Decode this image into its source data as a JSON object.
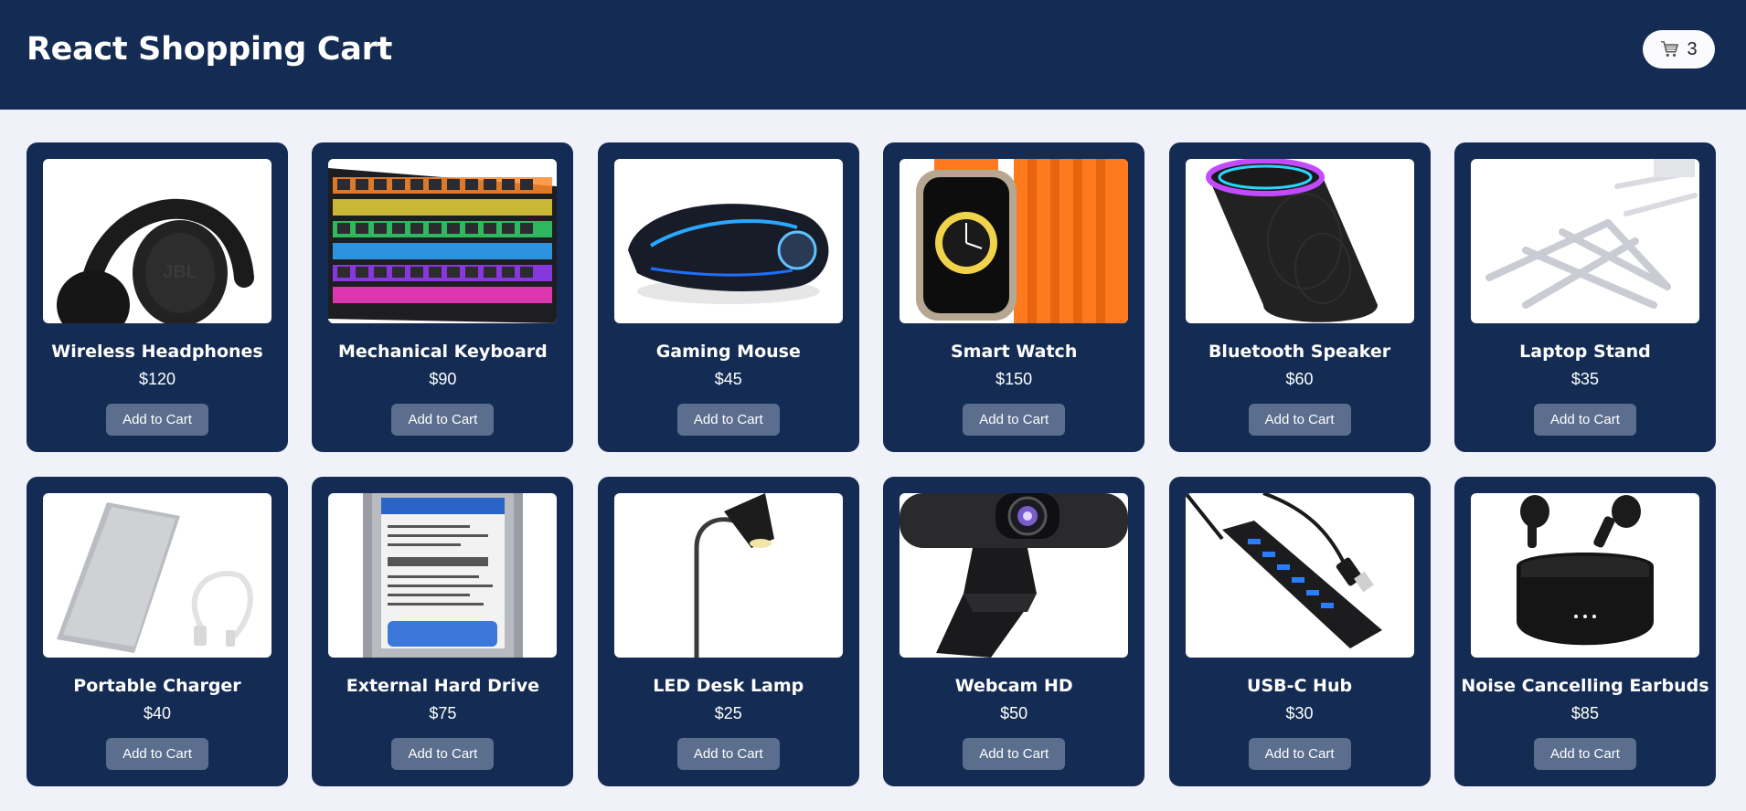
{
  "header": {
    "title": "React Shopping Cart",
    "cart_icon": "shopping-cart-icon",
    "cart_count": "3"
  },
  "colors": {
    "header_bg": "#142c53",
    "card_bg": "#142c53",
    "button_bg": "#5b6e8e",
    "page_bg": "#f1f2f9"
  },
  "products": [
    {
      "name": "Wireless Headphones",
      "price": "$120",
      "button_label": "Add to Cart"
    },
    {
      "name": "Mechanical Keyboard",
      "price": "$90",
      "button_label": "Add to Cart"
    },
    {
      "name": "Gaming Mouse",
      "price": "$45",
      "button_label": "Add to Cart"
    },
    {
      "name": "Smart Watch",
      "price": "$150",
      "button_label": "Add to Cart"
    },
    {
      "name": "Bluetooth Speaker",
      "price": "$60",
      "button_label": "Add to Cart"
    },
    {
      "name": "Laptop Stand",
      "price": "$35",
      "button_label": "Add to Cart"
    },
    {
      "name": "Portable Charger",
      "price": "$40",
      "button_label": "Add to Cart"
    },
    {
      "name": "External Hard Drive",
      "price": "$75",
      "button_label": "Add to Cart"
    },
    {
      "name": "LED Desk Lamp",
      "price": "$25",
      "button_label": "Add to Cart"
    },
    {
      "name": "Webcam HD",
      "price": "$50",
      "button_label": "Add to Cart"
    },
    {
      "name": "USB-C Hub",
      "price": "$30",
      "button_label": "Add to Cart"
    },
    {
      "name": "Noise Cancelling Earbuds",
      "price": "$85",
      "button_label": "Add to Cart"
    }
  ]
}
